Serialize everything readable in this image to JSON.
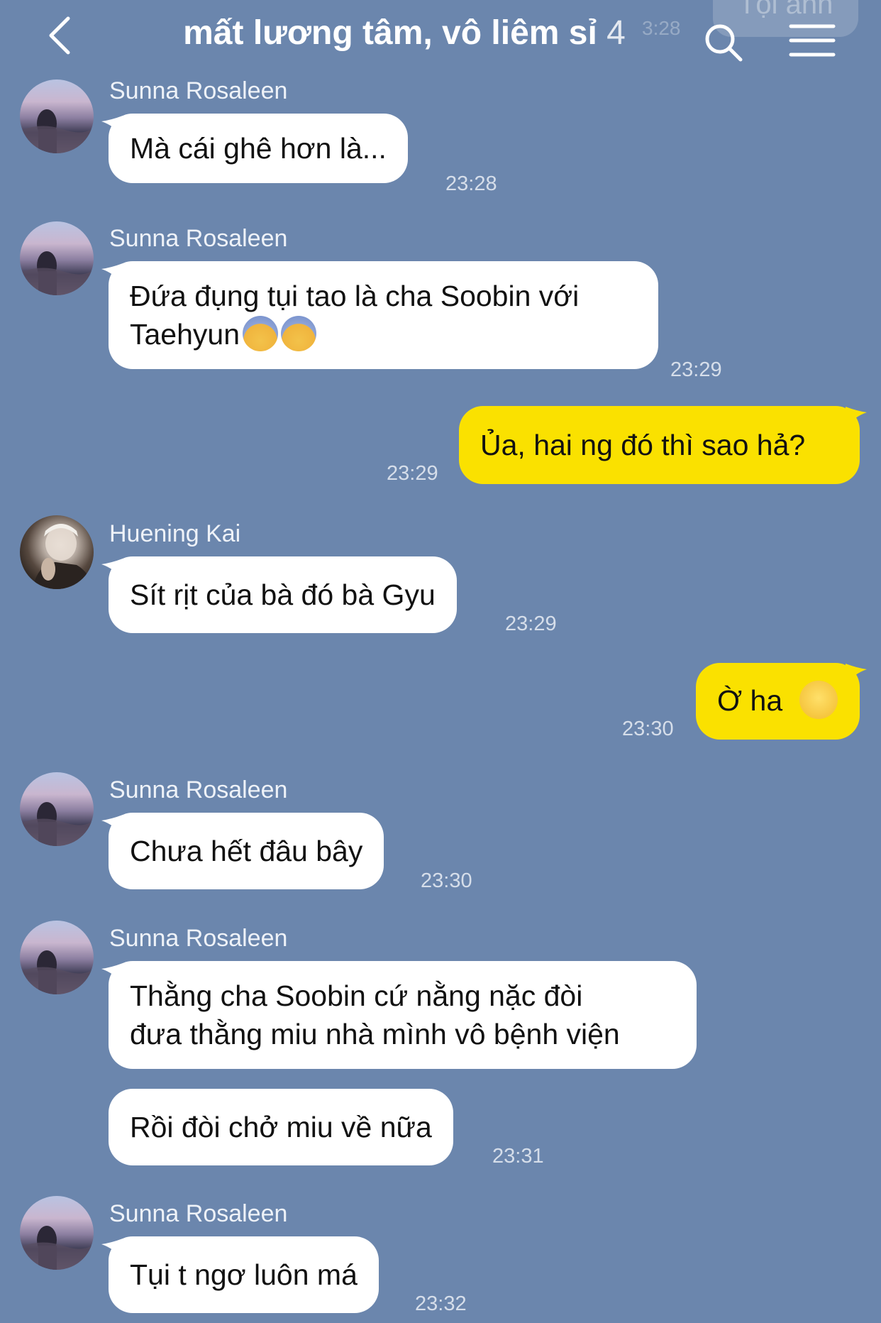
{
  "header": {
    "title": "mất lương tâm, vô liêm sỉ",
    "member_count": "4",
    "ghost_bubble": "Tội anh",
    "ghost_time": "3:28"
  },
  "messages": [
    {
      "sender": "Sunna Rosaleen",
      "text": "Mà cái ghê hơn là...",
      "time": "23:28",
      "side": "in"
    },
    {
      "sender": "Sunna Rosaleen",
      "line1": "Đứa đụng tụi tao là cha Soobin với",
      "line2": "Taehyun",
      "emoji": "😰😰",
      "time": "23:29",
      "side": "in"
    },
    {
      "text": "Ủa, hai ng đó thì sao hả?",
      "time": "23:29",
      "side": "out"
    },
    {
      "sender": "Huening Kai",
      "text": "Sít rịt của bà đó bà Gyu",
      "time": "23:29",
      "side": "in"
    },
    {
      "text": "Ờ ha",
      "emoji": "🙂",
      "time": "23:30",
      "side": "out"
    },
    {
      "sender": "Sunna Rosaleen",
      "text": "Chưa hết đâu bây",
      "time": "23:30",
      "side": "in"
    },
    {
      "sender": "Sunna Rosaleen",
      "line1": "Thằng cha Soobin cứ nằng nặc đòi",
      "line2": "đưa thằng miu nhà mình vô bệnh viện",
      "side": "in"
    },
    {
      "text": "Rồi đòi chở miu về nữa",
      "time": "23:31",
      "side": "in"
    },
    {
      "sender": "Sunna Rosaleen",
      "text": "Tụi t ngơ luôn má",
      "time": "23:32",
      "side": "in"
    }
  ],
  "colors": {
    "background": "#6b86ad",
    "incoming_bubble": "#ffffff",
    "outgoing_bubble": "#fae100",
    "timestamp": "#d6deea"
  },
  "icons": {
    "back": "chevron-left-icon",
    "search": "search-icon",
    "menu": "hamburger-menu-icon"
  }
}
